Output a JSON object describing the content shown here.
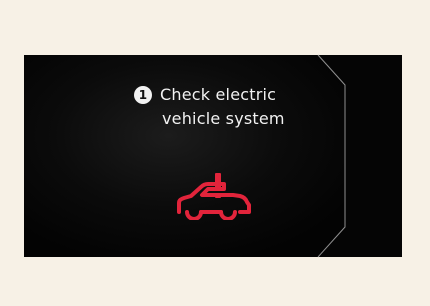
{
  "colors": {
    "background": "#f7f1e6",
    "screen": "#050505",
    "screen_highlight": "#1a1a1a",
    "text": "#f2f2f2",
    "warning": "#e2243b",
    "bezel_edge": "#8f8f8f"
  },
  "message": {
    "step_number": "1",
    "line1": "Check electric",
    "line2": "vehicle system"
  },
  "icons": {
    "warning": "car-warning-icon"
  }
}
